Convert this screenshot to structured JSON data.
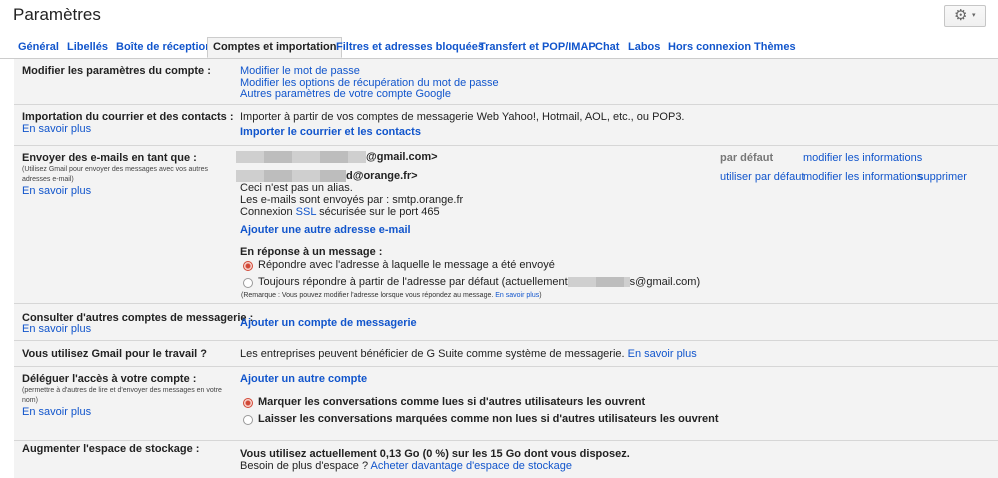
{
  "header": {
    "title": "Paramètres",
    "gear_caret": "▾"
  },
  "tabs": [
    {
      "label": "Général"
    },
    {
      "label": "Libellés"
    },
    {
      "label": "Boîte de réception"
    },
    {
      "label": "Comptes et importation",
      "active": true
    },
    {
      "label": "Filtres et adresses bloquées"
    },
    {
      "label": "Transfert et POP/IMAP"
    },
    {
      "label": "Chat"
    },
    {
      "label": "Labos"
    },
    {
      "label": "Hors connexion"
    },
    {
      "label": "Thèmes"
    }
  ],
  "account": {
    "label": "Modifier les paramètres du compte :",
    "links": [
      "Modifier le mot de passe",
      "Modifier les options de récupération du mot de passe",
      "Autres paramètres de votre compte Google"
    ]
  },
  "import": {
    "label": "Importation du courrier et des contacts :",
    "learn_more": "En savoir plus",
    "description": "Importer à partir de vos comptes de messagerie Web Yahoo!, Hotmail, AOL, etc., ou POP3.",
    "action": "Importer le courrier et les contacts"
  },
  "send_as": {
    "label": "Envoyer des e-mails en tant que :",
    "note": "(Utilisez Gmail pour envoyer des messages avec vos autres adresses e-mail)",
    "learn_more": "En savoir plus",
    "address1_suffix": "@gmail.com>",
    "address2_suffix": "d@orange.fr>",
    "default_label": "par défaut",
    "modify_info": "modifier les informations",
    "use_default": "utiliser par défaut",
    "delete": "supprimer",
    "not_alias": "Ceci n'est pas un alias.",
    "sent_via": "Les e-mails sont envoyés par : smtp.orange.fr",
    "conn_prefix": "Connexion",
    "ssl": "SSL",
    "conn_suffix": "sécurisée sur le port 465",
    "add_address": "Ajouter une autre adresse e-mail",
    "reply_heading": "En réponse à un message :",
    "reply_opt1": "Répondre avec l'adresse à laquelle le message a été envoyé",
    "reply_opt2_prefix": "Toujours répondre à partir de l'adresse par défaut (actuellement",
    "reply_opt2_suffix": "s@gmail.com)",
    "remark_text": "(Remarque : Vous pouvez modifier l'adresse lorsque vous répondez au message.",
    "remark_link": "En savoir plus",
    "remark_close": ")"
  },
  "check_mail": {
    "label": "Consulter d'autres comptes de messagerie :",
    "learn_more": "En savoir plus",
    "action": "Ajouter un compte de messagerie"
  },
  "work": {
    "label": "Vous utilisez Gmail pour le travail ?",
    "text": "Les entreprises peuvent bénéficier de G Suite comme système de messagerie.",
    "learn_more": "En savoir plus"
  },
  "delegate": {
    "label": "Déléguer l'accès à votre compte :",
    "note": "(permettre à d'autres de lire et d'envoyer des messages en votre nom)",
    "learn_more": "En savoir plus",
    "action": "Ajouter un autre compte",
    "opt1": "Marquer les conversations comme lues si d'autres utilisateurs les ouvrent",
    "opt2": "Laisser les conversations marquées comme non lues si d'autres utilisateurs les ouvrent"
  },
  "storage": {
    "label": "Augmenter l'espace de stockage :",
    "usage": "Vous utilisez actuellement 0,13 Go (0 %) sur les 15 Go dont vous disposez.",
    "need_more": "Besoin de plus d'espace ?",
    "buy": "Acheter davantage d'espace de stockage"
  },
  "colors": {
    "link": "#1155cc",
    "accent": "#d14836",
    "panel": "#f3f3f3"
  }
}
